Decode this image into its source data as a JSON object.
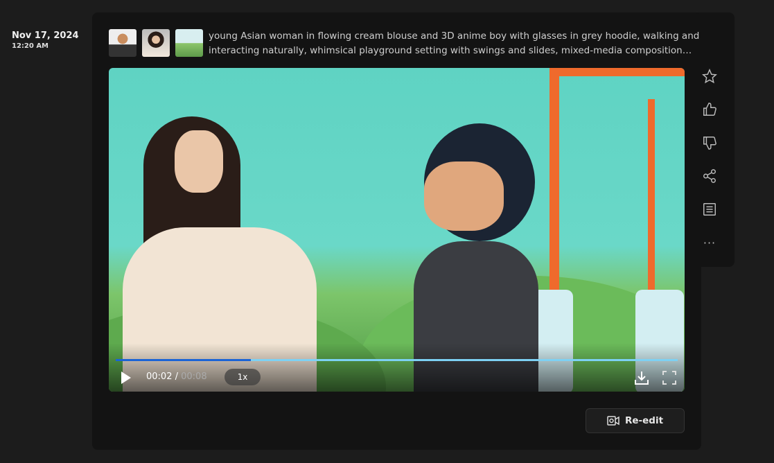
{
  "entry": {
    "date": "Nov 17, 2024",
    "time": "12:20 AM"
  },
  "prompt": "young Asian woman in flowing cream blouse and 3D anime boy with glasses in grey hoodie, walking and interacting naturally, whimsical playground setting with swings and slides, mixed-media composition…",
  "thumbnails": [
    {
      "name": "anime-boy"
    },
    {
      "name": "asian-woman"
    },
    {
      "name": "playground"
    }
  ],
  "player": {
    "current": "00:02",
    "separator": " / ",
    "total": "00:08",
    "speed": "1x",
    "progress_percent": 24,
    "progress_color": "#1a64d6"
  },
  "actions": [
    {
      "name": "favorite",
      "icon": "star-icon"
    },
    {
      "name": "like",
      "icon": "thumbs-up-icon"
    },
    {
      "name": "dislike",
      "icon": "thumbs-down-icon"
    },
    {
      "name": "share",
      "icon": "share-icon"
    },
    {
      "name": "details",
      "icon": "document-icon"
    },
    {
      "name": "more",
      "icon": "more-icon"
    }
  ],
  "reedit_label": "Re-edit"
}
